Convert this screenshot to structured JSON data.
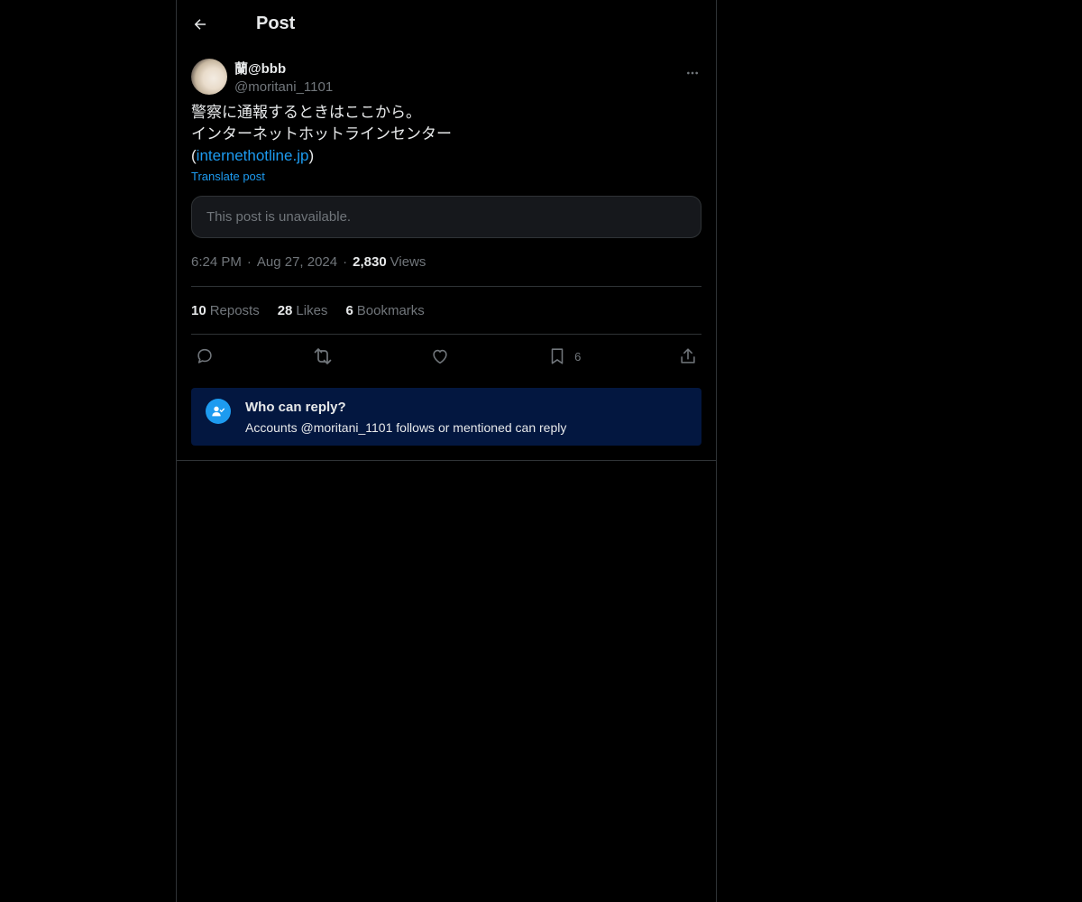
{
  "header": {
    "title": "Post",
    "back_icon": "arrow-left-icon"
  },
  "author": {
    "display_name": "蘭@bbb",
    "handle": "@moritani_1101"
  },
  "post": {
    "line1": "警察に通報するときはここから。",
    "line2": "インターネットホットラインセンター",
    "paren_open": "(",
    "link_text": "internethotline.jp",
    "paren_close": ")",
    "translate_label": "Translate post",
    "quoted_unavailable": "This post is unavailable."
  },
  "meta": {
    "time": "6:24 PM",
    "separator": "·",
    "date": "Aug 27, 2024",
    "views_count": "2,830",
    "views_label": "Views"
  },
  "stats": {
    "reposts_count": "10",
    "reposts_label": "Reposts",
    "likes_count": "28",
    "likes_label": "Likes",
    "bookmarks_count": "6",
    "bookmarks_label": "Bookmarks"
  },
  "actions": {
    "icons": [
      "reply-icon",
      "repost-icon",
      "like-icon",
      "bookmark-icon",
      "share-icon"
    ],
    "bookmark_count": "6"
  },
  "reply_restriction": {
    "title": "Who can reply?",
    "subtitle": "Accounts @moritani_1101 follows or mentioned can reply"
  },
  "colors": {
    "background": "#000000",
    "text_primary": "#e7e9ea",
    "text_secondary": "#71767b",
    "accent": "#1d9bf0",
    "notice_background": "#031740",
    "border": "#2f3336"
  }
}
